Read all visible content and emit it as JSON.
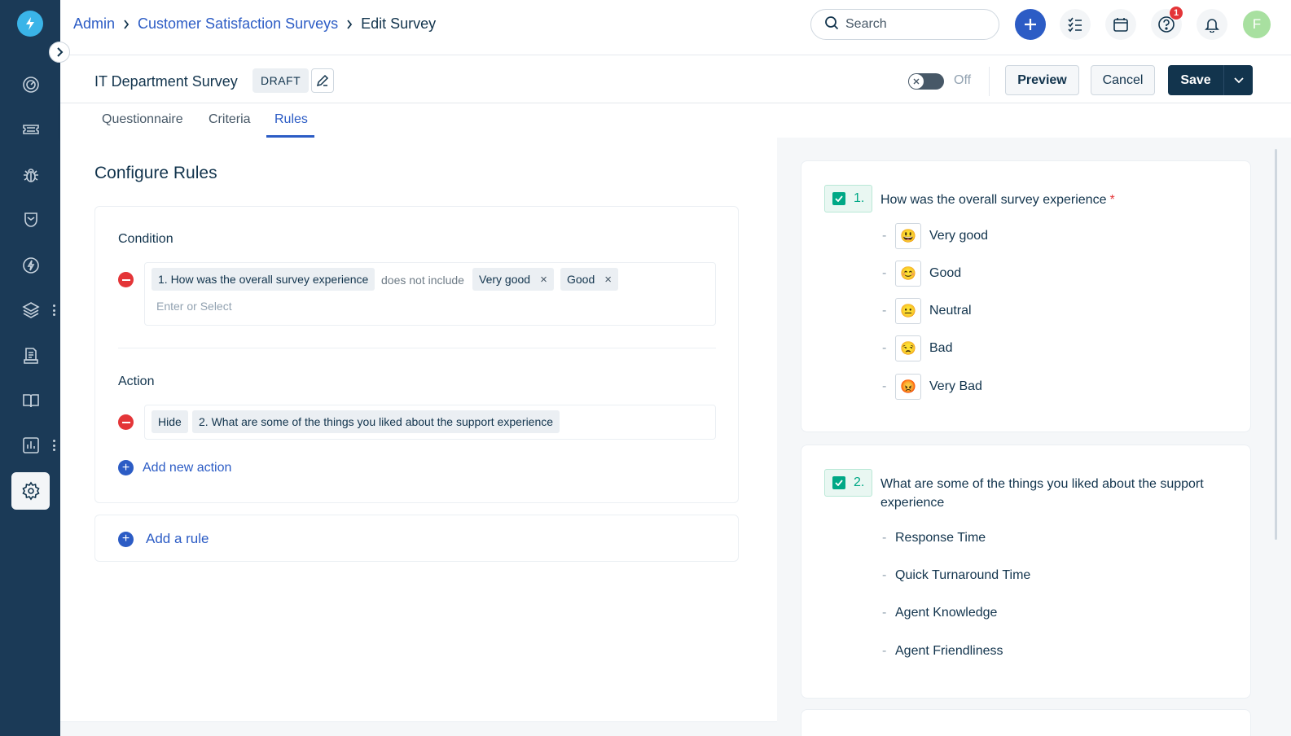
{
  "breadcrumb": {
    "admin": "Admin",
    "surveys": "Customer Satisfaction Surveys",
    "current": "Edit Survey"
  },
  "search": {
    "placeholder": "Search"
  },
  "help_badge": "1",
  "avatar": "F",
  "survey": {
    "title": "IT Department Survey",
    "status": "DRAFT",
    "toggle_label": "Off",
    "preview_label": "Preview",
    "cancel_label": "Cancel",
    "save_label": "Save"
  },
  "tabs": [
    {
      "label": "Questionnaire"
    },
    {
      "label": "Criteria"
    },
    {
      "label": "Rules"
    }
  ],
  "rules": {
    "title": "Configure Rules",
    "condition_label": "Condition",
    "condition": {
      "question": "1. How was the overall survey experience",
      "operator": "does not include",
      "values": [
        "Very good",
        "Good"
      ],
      "placeholder": "Enter or Select"
    },
    "action_label": "Action",
    "action": {
      "type": "Hide",
      "question": "2. What are some of the things you liked about the support experience"
    },
    "add_action": "Add new action",
    "add_rule": "Add a rule"
  },
  "preview": {
    "q1": {
      "number": "1.",
      "text": "How was the overall survey experience",
      "required": "*",
      "options": [
        {
          "emoji": "😃",
          "label": "Very good"
        },
        {
          "emoji": "😊",
          "label": "Good"
        },
        {
          "emoji": "😐",
          "label": "Neutral"
        },
        {
          "emoji": "😒",
          "label": "Bad"
        },
        {
          "emoji": "😡",
          "label": "Very Bad"
        }
      ]
    },
    "q2": {
      "number": "2.",
      "text_line1": "What are some of the things you liked about the support",
      "text_line2": "experience",
      "options": [
        {
          "label": "Response Time"
        },
        {
          "label": "Quick Turnaround Time"
        },
        {
          "label": "Agent Knowledge"
        },
        {
          "label": "Agent Friendliness"
        }
      ]
    }
  },
  "dash": "-",
  "remove_glyph": "×",
  "colors": {
    "sidebar": "#1b3a57",
    "primary": "#2c5cc5",
    "danger": "#e43538",
    "success": "#00a886",
    "dark": "#12344d"
  }
}
